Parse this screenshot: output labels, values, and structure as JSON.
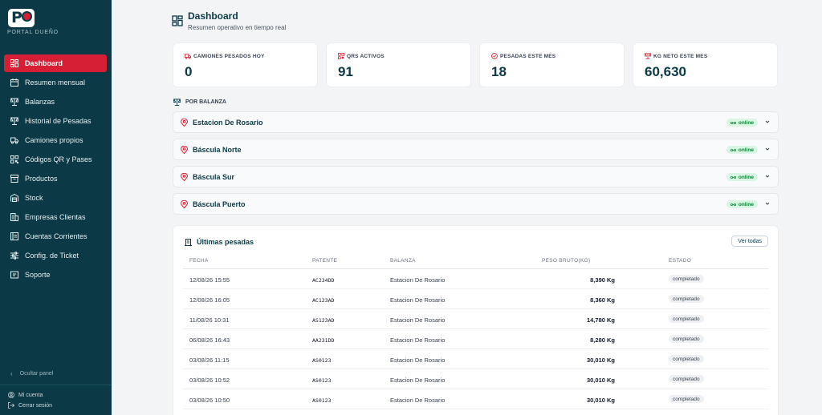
{
  "sidebar": {
    "logo_letter": "P",
    "portal_label": "PORTAL DUEÑO",
    "items": [
      {
        "label": "Dashboard",
        "icon": "dashboard-icon",
        "active": true
      },
      {
        "label": "Resumen mensual",
        "icon": "calendar-icon"
      },
      {
        "label": "Balanzas",
        "icon": "scale-icon"
      },
      {
        "label": "Historial de Pesadas",
        "icon": "history-scale-icon"
      },
      {
        "label": "Camiones propios",
        "icon": "truck-icon"
      },
      {
        "label": "Códigos QR y Pases",
        "icon": "qr-icon"
      },
      {
        "label": "Productos",
        "icon": "box-icon"
      },
      {
        "label": "Stock",
        "icon": "warehouse-icon"
      },
      {
        "label": "Empresas Clientas",
        "icon": "building-icon"
      },
      {
        "label": "Cuentas Corrientes",
        "icon": "ledger-icon"
      },
      {
        "label": "Config. de Ticket",
        "icon": "sliders-icon"
      },
      {
        "label": "Soporte",
        "icon": "support-icon"
      }
    ],
    "hide_panel": "Ocultar panel",
    "account": "Mi cuenta",
    "logout": "Cerrar sesión"
  },
  "header": {
    "title": "Dashboard",
    "subtitle": "Resumen operativo en tiempo real"
  },
  "stats": [
    {
      "label": "CAMIONES PESADOS HOY",
      "value": "0",
      "icon": "truck-icon"
    },
    {
      "label": "QRS ACTIVOS",
      "value": "91",
      "icon": "qr-icon"
    },
    {
      "label": "PESADAS ESTE MES",
      "value": "18",
      "icon": "check-circle-icon"
    },
    {
      "label": "KG NETO ESTE MES",
      "value": "60,630",
      "icon": "scale-icon"
    }
  ],
  "balanzas": {
    "section_label": "POR BALANZA",
    "items": [
      {
        "name": "Estacion De Rosario",
        "status": "online"
      },
      {
        "name": "Báscula Norte",
        "status": "online"
      },
      {
        "name": "Báscula Sur",
        "status": "online"
      },
      {
        "name": "Báscula Puerto",
        "status": "online"
      }
    ]
  },
  "pesadas": {
    "title": "Últimas pesadas",
    "ver_todas": "Ver todas",
    "columns": {
      "fecha": "FECHA",
      "patente": "PATENTE",
      "balanza": "BALANZA",
      "peso": "PESO BRUTO(KG)",
      "estado": "ESTADO"
    },
    "rows": [
      {
        "fecha": "12/08/26 15:55",
        "patente": "AC234DD",
        "balanza": "Estacion De Rosario",
        "peso": "8,390 Kg",
        "estado": "completado"
      },
      {
        "fecha": "12/08/26 16:05",
        "patente": "AC123AD",
        "balanza": "Estacion De Rosario",
        "peso": "8,360 Kg",
        "estado": "completado"
      },
      {
        "fecha": "11/08/26 10:31",
        "patente": "AS123AD",
        "balanza": "Estacion De Rosario",
        "peso": "14,780 Kg",
        "estado": "completado"
      },
      {
        "fecha": "06/08/26 16:43",
        "patente": "AA231DD",
        "balanza": "Estacion De Rosario",
        "peso": "8,280 Kg",
        "estado": "completado"
      },
      {
        "fecha": "03/08/26 11:15",
        "patente": "AS0123",
        "balanza": "Estacion De Rosario",
        "peso": "30,010 Kg",
        "estado": "completado"
      },
      {
        "fecha": "03/08/26 10:52",
        "patente": "AS0123",
        "balanza": "Estacion De Rosario",
        "peso": "30,010 Kg",
        "estado": "completado"
      },
      {
        "fecha": "03/08/26 10:50",
        "patente": "AS0123",
        "balanza": "Estacion De Rosario",
        "peso": "30,010 Kg",
        "estado": "completado"
      }
    ]
  },
  "colors": {
    "sidebar_bg": "#0b3a46",
    "accent_red": "#d61f34",
    "online_green": "#15803d"
  }
}
